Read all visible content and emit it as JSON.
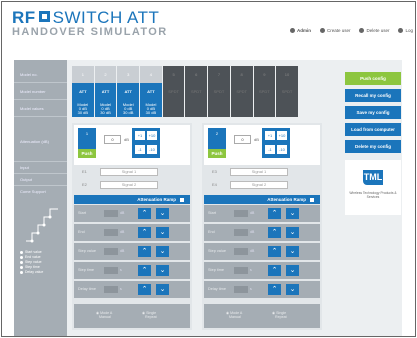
{
  "header": {
    "logo_line1_a": "RF",
    "logo_line1_b": "SWITCH ATT",
    "logo_line2": "HANDOVER SIMULATOR",
    "nav": {
      "admin": "Admin",
      "create": "Create user",
      "delete": "Delete user",
      "logout": "Log"
    }
  },
  "sidebar": {
    "rows": [
      "Model no.",
      "Model number",
      "Model values",
      "Attenuation (dB)",
      "Input",
      "Output",
      "Come Support"
    ],
    "legend": [
      "Start value",
      "End value",
      "Step value",
      "Step time",
      "Delay value"
    ]
  },
  "grid": {
    "row1": [
      "1",
      "2",
      "3",
      "4",
      "5",
      "6",
      "7",
      "8",
      "9",
      "10"
    ],
    "row2": [
      "ATT",
      "ATT",
      "ATT",
      "ATT",
      "SPDT",
      "SPDT",
      "SPDT",
      "SPDT",
      "SPDT",
      "SPDT"
    ],
    "row3": [
      "Model\n0 dB\n30 dB",
      "Model\n0 dB\n30 dB",
      "Model\n0 dB\n30 dB",
      "Model\n0 dB\n30 dB",
      "",
      "",
      "",
      "",
      "",
      ""
    ]
  },
  "att1": {
    "num": "1",
    "push": "Push",
    "value": "0",
    "unit": "dB",
    "steps": [
      "+1",
      "+10",
      "-1",
      "-10"
    ],
    "in_label": "E1",
    "in_value": "Signal 1",
    "out_label": "E2",
    "out_value": "Signal 2",
    "ramp": "Attenuation Ramp",
    "params": [
      "Start",
      "End",
      "Step value",
      "Step time",
      "Delay time"
    ],
    "param_values": [
      "0",
      "30",
      "1",
      "1",
      "1"
    ],
    "param_units": [
      "dB",
      "dB",
      "dB",
      "s",
      "s"
    ],
    "radio1a": "Mode A",
    "radio1b": "Manual",
    "radio2a": "Single",
    "radio2b": "Repeat"
  },
  "att2": {
    "num": "2",
    "push": "Push",
    "value": "0",
    "unit": "dB",
    "steps": [
      "+1",
      "+10",
      "-1",
      "-10"
    ],
    "in_label": "E3",
    "in_value": "Signal 1",
    "out_label": "E4",
    "out_value": "Signal 2",
    "ramp": "Attenuation Ramp",
    "params": [
      "Start",
      "End",
      "Step value",
      "Step time",
      "Delay time"
    ],
    "param_values": [
      "0",
      "30",
      "1",
      "1",
      "1"
    ],
    "param_units": [
      "dB",
      "dB",
      "dB",
      "s",
      "s"
    ],
    "radio1a": "Mode A",
    "radio1b": "Manual",
    "radio2a": "Single",
    "radio2b": "Repeat"
  },
  "actions": {
    "push": "Push config",
    "recall": "Recall my config",
    "save": "Save my config",
    "load": "Load from computer",
    "delete": "Delete my config"
  },
  "brand": {
    "mark": "TML",
    "text": "Wireless Technology Products & Services"
  }
}
